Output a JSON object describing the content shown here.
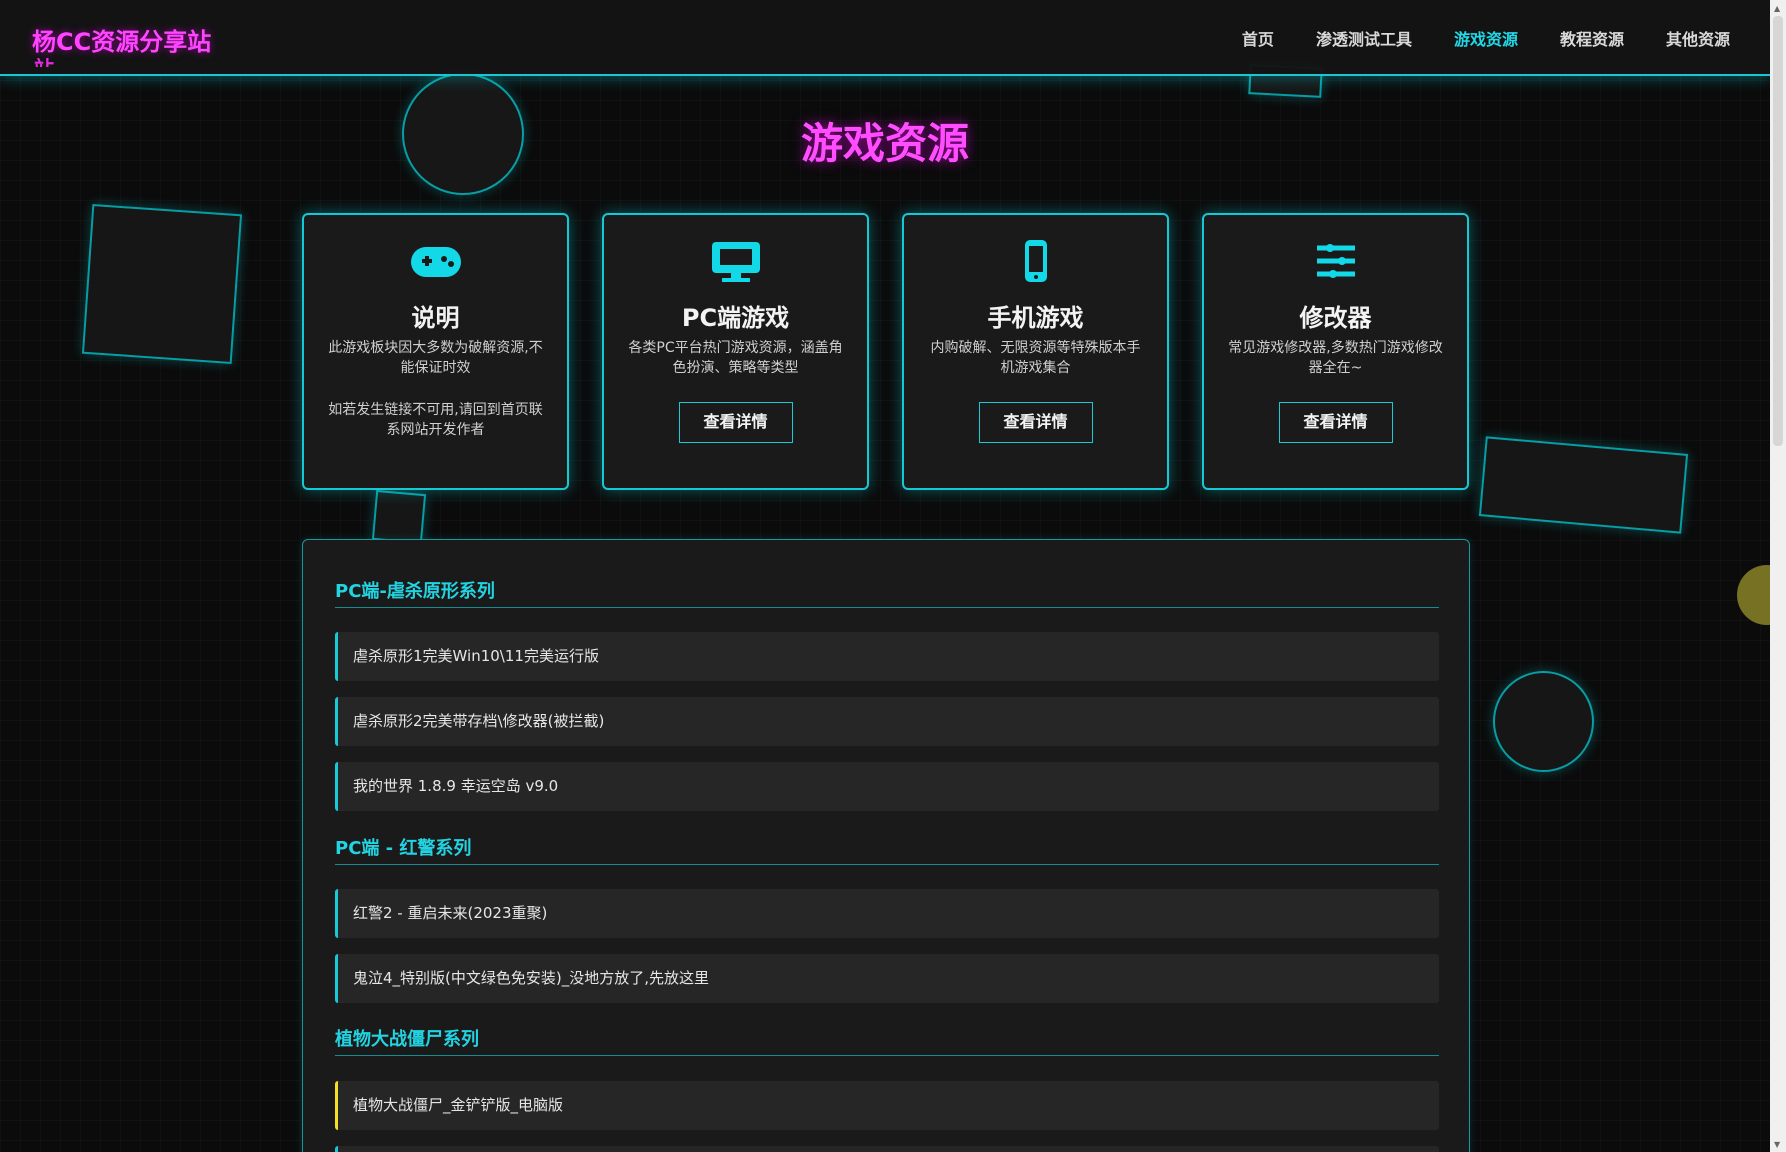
{
  "logo": {
    "text": "杨CC资源分享站",
    "overflow": "站"
  },
  "nav": {
    "items": [
      {
        "label": "首页",
        "active": false
      },
      {
        "label": "渗透测试工具",
        "active": false
      },
      {
        "label": "游戏资源",
        "active": true
      },
      {
        "label": "教程资源",
        "active": false
      },
      {
        "label": "其他资源",
        "active": false
      }
    ]
  },
  "title": "游戏资源",
  "cards": [
    {
      "icon": "gamepad-icon",
      "title": "说明",
      "text": "此游戏板块因大多数为破解资源,不能保证时效",
      "note": "如若发生链接不可用,请回到首页联系网站开发作者"
    },
    {
      "icon": "monitor-icon",
      "title": "PC端游戏",
      "text": "各类PC平台热门游戏资源，涵盖角色扮演、策略等类型",
      "button": "查看详情"
    },
    {
      "icon": "phone-icon",
      "title": "手机游戏",
      "text": "内购破解、无限资源等特殊版本手机游戏集合",
      "button": "查看详情"
    },
    {
      "icon": "sliders-icon",
      "title": "修改器",
      "text": "常见游戏修改器,多数热门游戏修改器全在~",
      "button": "查看详情"
    }
  ],
  "sections": [
    {
      "title": "PC端-虐杀原形系列",
      "items": [
        {
          "label": "虐杀原形1完美Win10\\11完美运行版"
        },
        {
          "label": "虐杀原形2完美带存档\\修改器(被拦截)"
        },
        {
          "label": "我的世界 1.8.9 幸运空岛 v9.0"
        }
      ]
    },
    {
      "title": "PC端 - 红警系列",
      "items": [
        {
          "label": "红警2 - 重启未来(2023重聚)"
        },
        {
          "label": "鬼泣4_特别版(中文绿色免安装)_没地方放了,先放这里"
        }
      ]
    },
    {
      "title": "植物大战僵尸系列",
      "items": [
        {
          "label": "植物大战僵尸_金铲铲版_电脑版",
          "accent": "#f2df26"
        }
      ]
    }
  ]
}
